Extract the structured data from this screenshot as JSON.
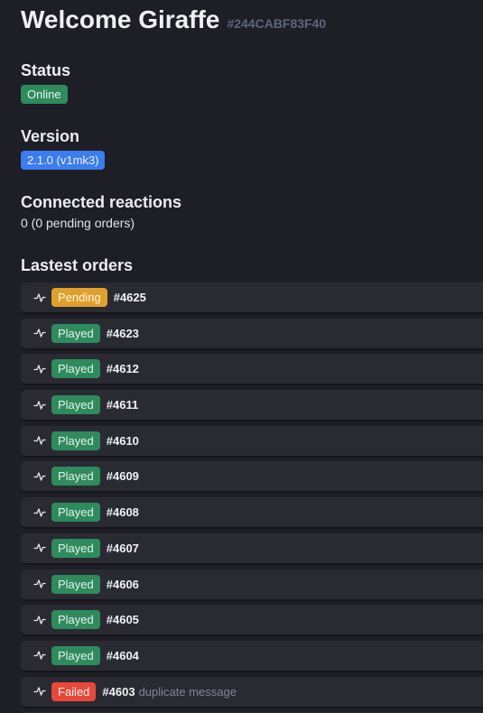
{
  "header": {
    "title": "Welcome Giraffe",
    "id": "#244CABF83F40"
  },
  "status": {
    "heading": "Status",
    "value": "Online"
  },
  "version": {
    "heading": "Version",
    "value": "2.1.0 (v1mk3)"
  },
  "reactions": {
    "heading": "Connected reactions",
    "value": "0 (0 pending orders)"
  },
  "orders": {
    "heading": "Lastest orders",
    "items": [
      {
        "state": "Pending",
        "id": "#4625",
        "note": ""
      },
      {
        "state": "Played",
        "id": "#4623",
        "note": ""
      },
      {
        "state": "Played",
        "id": "#4612",
        "note": ""
      },
      {
        "state": "Played",
        "id": "#4611",
        "note": ""
      },
      {
        "state": "Played",
        "id": "#4610",
        "note": ""
      },
      {
        "state": "Played",
        "id": "#4609",
        "note": ""
      },
      {
        "state": "Played",
        "id": "#4608",
        "note": ""
      },
      {
        "state": "Played",
        "id": "#4607",
        "note": ""
      },
      {
        "state": "Played",
        "id": "#4606",
        "note": ""
      },
      {
        "state": "Played",
        "id": "#4605",
        "note": ""
      },
      {
        "state": "Played",
        "id": "#4604",
        "note": ""
      },
      {
        "state": "Failed",
        "id": "#4603",
        "note": "duplicate message"
      },
      {
        "state": "",
        "id": "",
        "note": ""
      }
    ]
  },
  "colors": {
    "background": "#1e1e26",
    "row": "#2a2a33",
    "played": "#2f8a5d",
    "pending": "#e0a02c",
    "failed": "#e8473b",
    "version": "#3b7df0"
  },
  "icons": {
    "order_row": "activity-pulse-icon"
  }
}
